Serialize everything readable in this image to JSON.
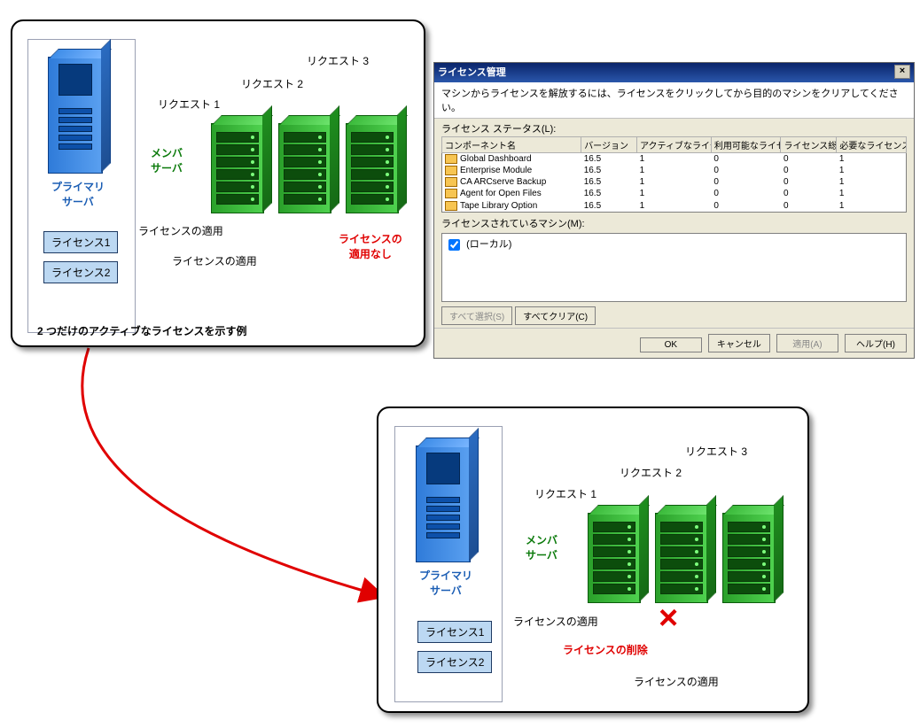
{
  "diagram1": {
    "primary_label": "プライマリ\nサーバ",
    "member_label": "メンバ\nサーバ",
    "license1": "ライセンス1",
    "license2": "ライセンス2",
    "apply1": "ライセンスの適用",
    "apply2": "ライセンスの適用",
    "not_applied": "ライセンスの\n適用なし",
    "request1": "リクエスト 1",
    "request2": "リクエスト 2",
    "request3": "リクエスト 3",
    "caption": "2 つだけのアクティブなライセンスを示す例"
  },
  "diagram2": {
    "primary_label": "プライマリ\nサーバ",
    "member_label": "メンバ\nサーバ",
    "license1": "ライセンス1",
    "license2": "ライセンス2",
    "apply1": "ライセンスの適用",
    "remove": "ライセンスの削除",
    "apply2": "ライセンスの適用",
    "request1": "リクエスト 1",
    "request2": "リクエスト 2",
    "request3": "リクエスト 3"
  },
  "dialog": {
    "title": "ライセンス管理",
    "message": "マシンからライセンスを解放するには、ライセンスをクリックしてから目的のマシンをクリアしてください。",
    "status_label": "ライセンス ステータス(L):",
    "headers": {
      "component": "コンポーネント名",
      "version": "バージョン",
      "active": "アクティブなライセン..",
      "available": "利用可能なライセ..",
      "total": "ライセンス総数",
      "needed": "必要なライセンス数（最.."
    },
    "rows": [
      {
        "name": "Global Dashboard",
        "version": "16.5",
        "active": "1",
        "available": "0",
        "total": "0",
        "needed": "1"
      },
      {
        "name": "Enterprise Module",
        "version": "16.5",
        "active": "1",
        "available": "0",
        "total": "0",
        "needed": "1"
      },
      {
        "name": "CA ARCserve Backup",
        "version": "16.5",
        "active": "1",
        "available": "0",
        "total": "0",
        "needed": "1"
      },
      {
        "name": "Agent for Open Files",
        "version": "16.5",
        "active": "1",
        "available": "0",
        "total": "0",
        "needed": "1"
      },
      {
        "name": "Tape Library Option",
        "version": "16.5",
        "active": "1",
        "available": "0",
        "total": "0",
        "needed": "1"
      }
    ],
    "machines_label": "ライセンスされているマシン(M):",
    "machine_name": "(ローカル)",
    "select_all": "すべて選択(S)",
    "clear_all": "すべてクリア(C)",
    "ok": "OK",
    "cancel": "キャンセル",
    "apply": "適用(A)",
    "help": "ヘルプ(H)"
  }
}
